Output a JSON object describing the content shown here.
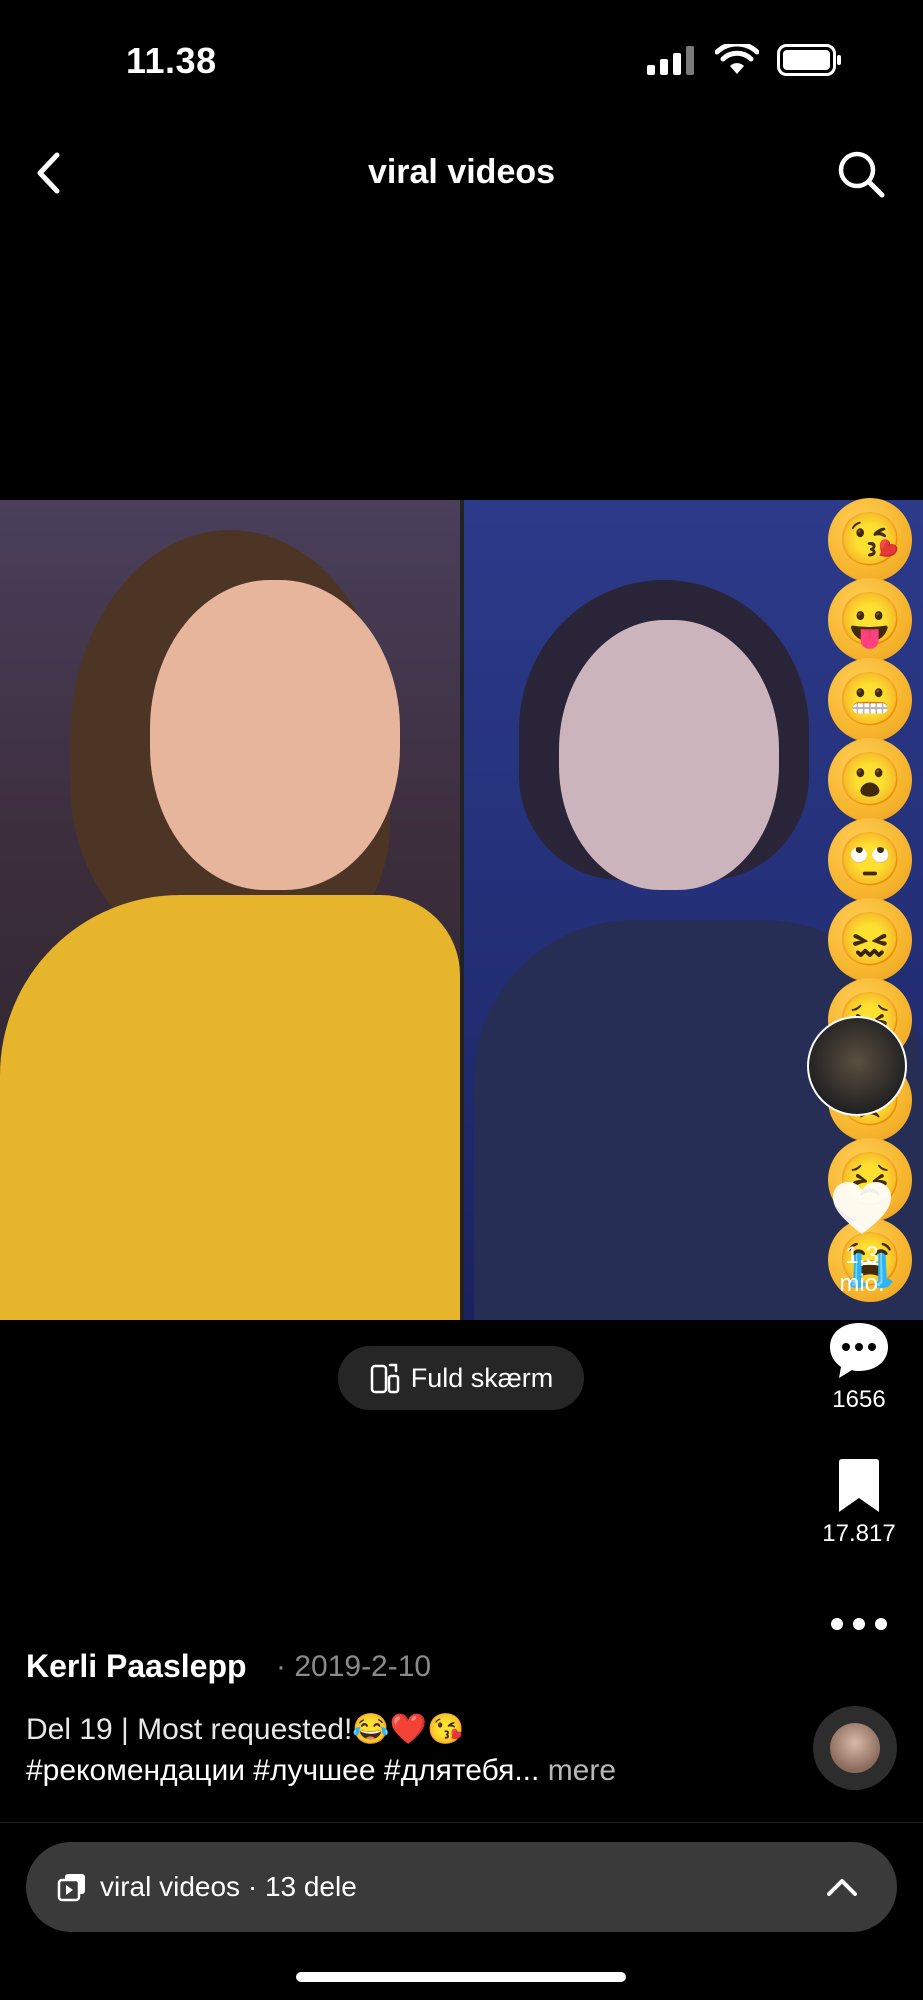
{
  "status_bar": {
    "time": "11.38"
  },
  "header": {
    "title": "viral videos"
  },
  "rail": {
    "like_count": "1,3 mio.",
    "comment_count": "1656",
    "save_count": "17.817"
  },
  "reactions": [
    "😘",
    "😛",
    "😬",
    "😮",
    "🙄",
    "😖",
    "😣",
    "😞",
    "😣",
    "😭"
  ],
  "fullscreen": {
    "label": "Fuld skærm"
  },
  "post": {
    "author": "Kerli Paaslepp",
    "date": "· 2019-2-10",
    "caption_line1": "Del 19 | Most requested!😂❤️😘",
    "caption_line2": "#рекомендации #лучшее #длятебя...",
    "more_label": " mere"
  },
  "playlist": {
    "label": "viral videos · 13 dele"
  }
}
